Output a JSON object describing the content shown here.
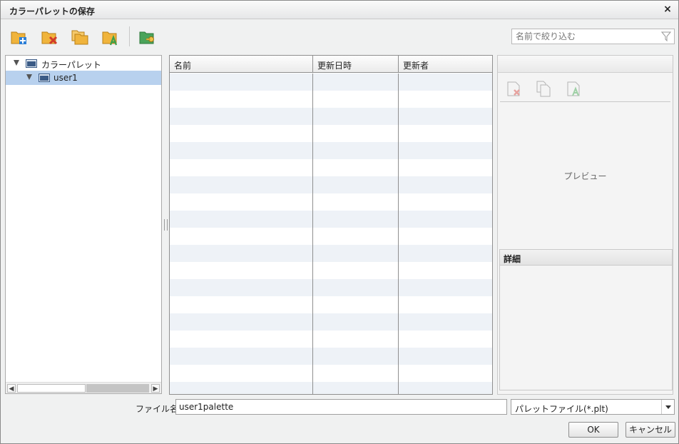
{
  "window": {
    "title": "カラーパレットの保存",
    "close_glyph": "×"
  },
  "toolbar": {
    "buttons": [
      {
        "icon": "new-folder-icon"
      },
      {
        "icon": "delete-folder-icon"
      },
      {
        "icon": "copy-folder-icon"
      },
      {
        "icon": "rename-folder-icon"
      },
      {
        "icon": "folder-permission-icon"
      }
    ]
  },
  "search": {
    "placeholder": "名前で絞り込む",
    "icon": "filter-icon"
  },
  "tree": {
    "root": {
      "label": "カラーパレット",
      "icon": "folder-icon",
      "expanded": true
    },
    "child": {
      "label": "user1",
      "icon": "folder-icon",
      "selected": true,
      "expanded": true
    }
  },
  "list": {
    "columns": [
      "名前",
      "更新日時",
      "更新者"
    ],
    "rows": []
  },
  "preview": {
    "buttons": [
      {
        "icon": "delete-file-icon"
      },
      {
        "icon": "copy-file-icon"
      },
      {
        "icon": "rename-file-icon"
      }
    ],
    "label": "プレビュー",
    "detail_title": "詳細"
  },
  "footer": {
    "filename_label": "ファイル名",
    "filename_value": "user1palette",
    "filetype": "パレットファイル(*.plt)",
    "ok_label": "OK",
    "cancel_label": "キャンセル"
  },
  "colors": {
    "selection": "#b8d1ee",
    "row_alt": "#eef2f7",
    "folder": "#f0b43c",
    "accent_add": "#2c7fd6",
    "accent_delete": "#d23a2a",
    "accent_green": "#3aa04a"
  }
}
